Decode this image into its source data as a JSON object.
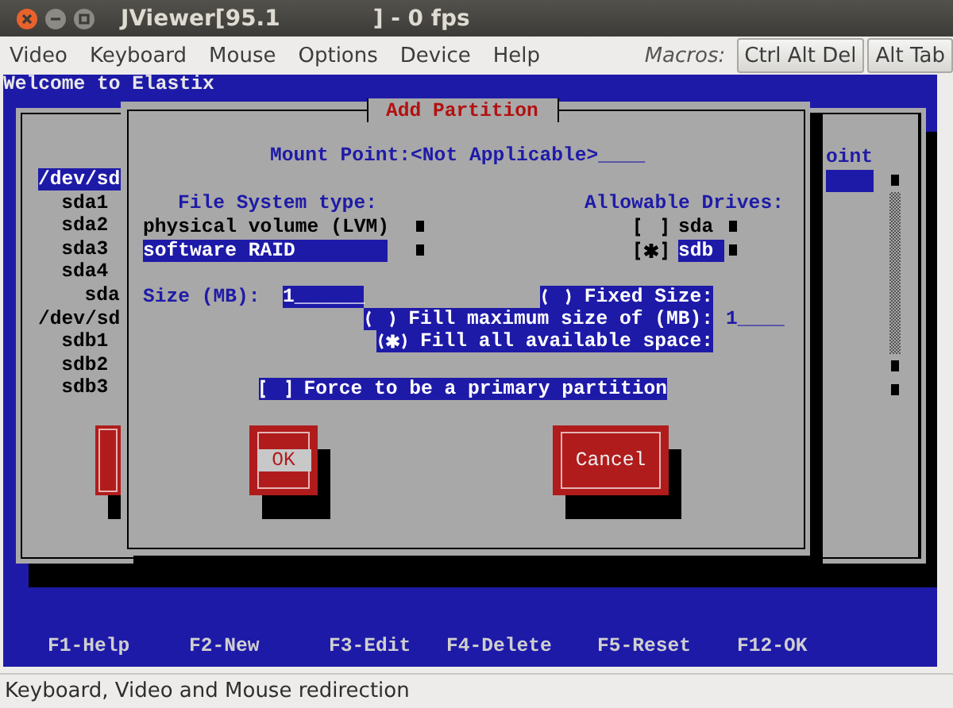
{
  "window": {
    "title": "JViewer[95.1            ] - 0 fps"
  },
  "menu": [
    {
      "label": "Video"
    },
    {
      "label": "Keyboard"
    },
    {
      "label": "Mouse"
    },
    {
      "label": "Options"
    },
    {
      "label": "Device"
    },
    {
      "label": "Help"
    }
  ],
  "macros": {
    "label": "Macros:",
    "buttons": [
      "Ctrl Alt Del",
      "Alt Tab"
    ]
  },
  "console": {
    "banner": "Welcome to Elastix",
    "partition_list": [
      {
        "label": "/dev/sd",
        "selected": true,
        "children": [
          {
            "label": "sda1",
            "selected": false
          },
          {
            "label": "sda2",
            "selected": false
          },
          {
            "label": "sda3",
            "selected": false
          },
          {
            "label": "sda4",
            "selected": false,
            "children": [
              {
                "label": "sda",
                "selected": false
              }
            ]
          }
        ]
      },
      {
        "label": "/dev/sd",
        "selected": false,
        "children": [
          {
            "label": "sdb1",
            "selected": false
          },
          {
            "label": "sdb2",
            "selected": false
          },
          {
            "label": "sdb3",
            "selected": false
          }
        ]
      }
    ],
    "partition_header": "oint",
    "dialog": {
      "title": "Add Partition",
      "mount_point": "Mount Point:<Not Applicable>____",
      "file_system_type": {
        "label": "File System type:",
        "options": [
          {
            "label": "physical volume (LVM)",
            "selected": false
          },
          {
            "label": "software RAID",
            "selected": true
          }
        ]
      },
      "allowable_drives": {
        "label": "Allowable Drives:",
        "drives": [
          {
            "label": "sda",
            "checked": false,
            "selected": false
          },
          {
            "label": "sdb",
            "checked": true,
            "selected": true
          }
        ]
      },
      "size": {
        "label": "Size (MB):",
        "value": "1______"
      },
      "size_options": [
        {
          "label": "Fixed Size:",
          "selected": false
        },
        {
          "label": "Fill maximum size of (MB):",
          "selected": false,
          "value": "1____"
        },
        {
          "label": "Fill all available space:",
          "selected": true
        }
      ],
      "primary": {
        "label": "Force to be a primary partition",
        "checked": false
      },
      "buttons": [
        {
          "label": "OK",
          "focused": true
        },
        {
          "label": "Cancel",
          "focused": false
        }
      ]
    },
    "function_keys": [
      "F1-Help",
      "F2-New",
      "F3-Edit",
      "F4-Delete",
      "F5-Reset",
      "F12-OK"
    ]
  },
  "status_bar": "Keyboard, Video and Mouse redirection"
}
